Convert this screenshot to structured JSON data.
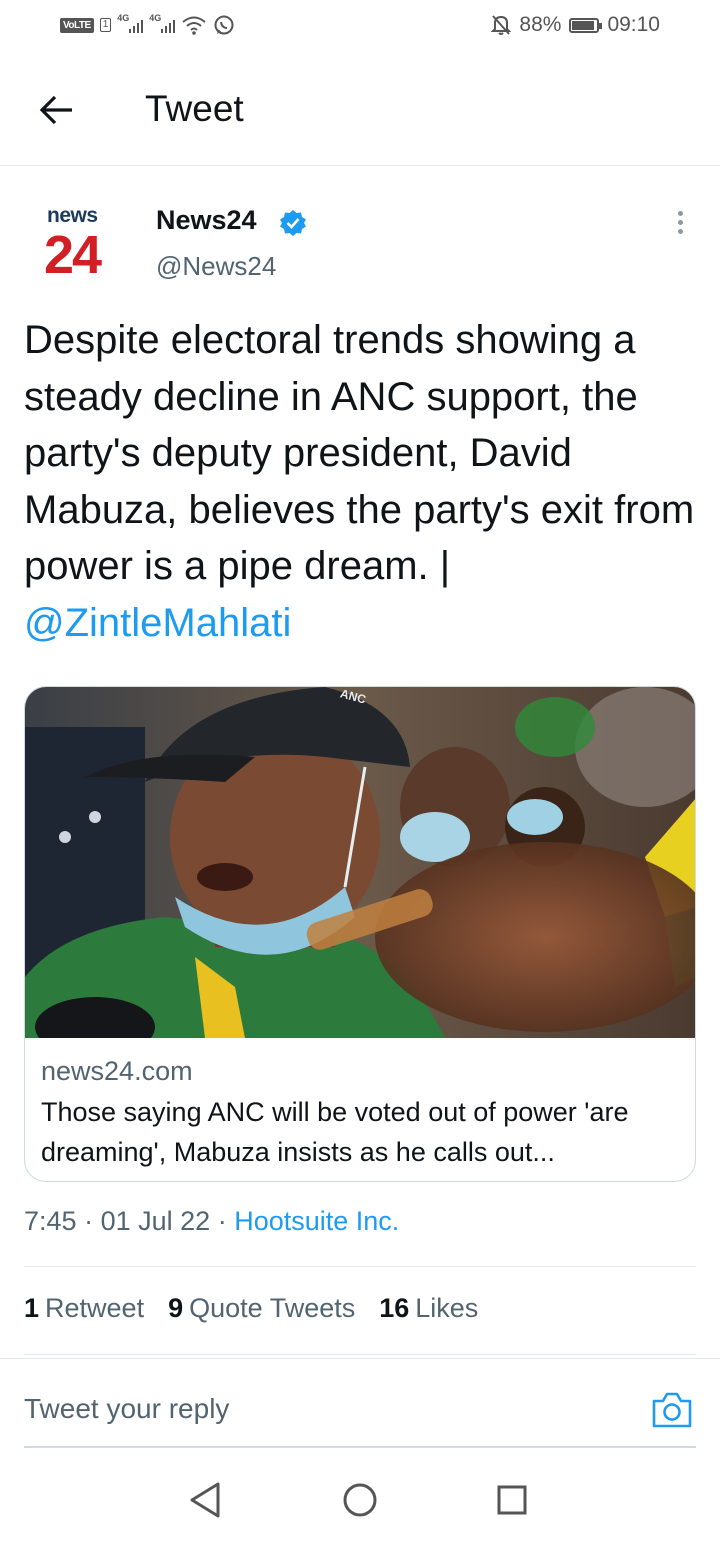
{
  "status_bar": {
    "left_badge": "VoLTE",
    "sim_badge": "1",
    "network_1": "4G",
    "network_2": "4G",
    "battery_text": "88%",
    "battery_level": 0.88,
    "time": "09:10",
    "icons": [
      "signal-icon",
      "signal-icon",
      "wifi-icon",
      "whatsapp-icon",
      "mute-icon",
      "battery-icon"
    ]
  },
  "header": {
    "title": "Tweet"
  },
  "tweet": {
    "avatar": {
      "line1": "news",
      "line2": "24"
    },
    "author_name": "News24",
    "author_handle": "@News24",
    "text": "Despite electoral trends showing a steady decline in ANC support, the party's deputy president, David Mabuza, believes the party's exit from power is a pipe dream. | ",
    "mention": "@ZintleMahlati",
    "card": {
      "image_text": "ANC",
      "domain": "news24.com",
      "title": "Those saying ANC will be voted out of power 'are dreaming', Mabuza insists as he calls out..."
    },
    "time": "7:45",
    "date": "01 Jul 22",
    "separator": "·",
    "source": "Hootsuite Inc.",
    "stats": [
      {
        "count": "1",
        "label": "Retweet"
      },
      {
        "count": "9",
        "label": "Quote Tweets"
      },
      {
        "count": "16",
        "label": "Likes"
      }
    ]
  },
  "reply": {
    "placeholder": "Tweet your reply"
  },
  "colors": {
    "accent": "#1d9bf0",
    "text": "#0f1419",
    "secondary": "#536471",
    "brand_red": "#d21f25"
  }
}
